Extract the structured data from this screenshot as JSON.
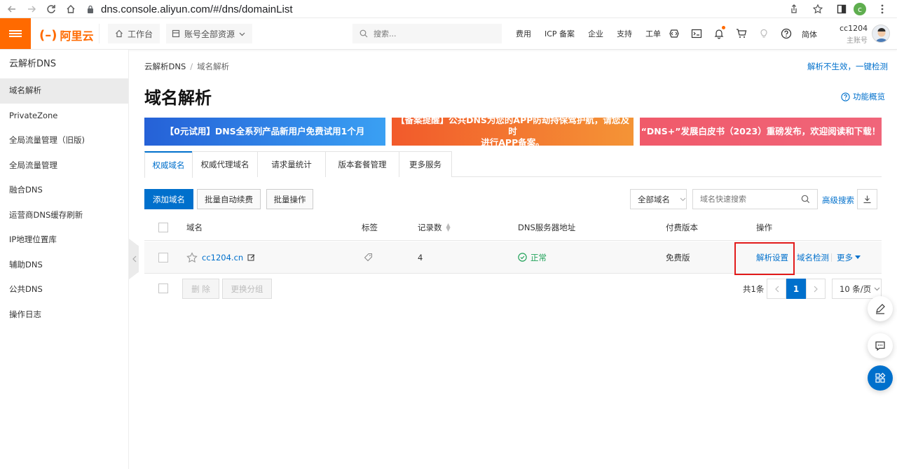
{
  "browser": {
    "url": "dns.console.aliyun.com/#/dns/domainList",
    "profile_letter": "c"
  },
  "header": {
    "logo_text": "阿里云",
    "workbench": "工作台",
    "resources": "账号全部资源",
    "search_placeholder": "搜索...",
    "links": [
      "费用",
      "ICP 备案",
      "企业",
      "支持",
      "工单"
    ],
    "lang": "简体",
    "username": "cc1204",
    "account_type": "主账号"
  },
  "sidebar": {
    "title": "云解析DNS",
    "items": [
      {
        "label": "域名解析",
        "active": true
      },
      {
        "label": "PrivateZone"
      },
      {
        "label": "全局流量管理（旧版)"
      },
      {
        "label": "全局流量管理"
      },
      {
        "label": "融合DNS"
      },
      {
        "label": "运营商DNS缓存刷新"
      },
      {
        "label": "IP地理位置库"
      },
      {
        "label": "辅助DNS"
      },
      {
        "label": "公共DNS"
      },
      {
        "label": "操作日志"
      }
    ]
  },
  "breadcrumb": {
    "root": "云解析DNS",
    "current": "域名解析"
  },
  "top_right_link": "解析不生效，一键检测",
  "page_title": "域名解析",
  "help_link": "功能概览",
  "banners": [
    {
      "text": "【0元试用】DNS全系列产品新用户免费试用1个月"
    },
    {
      "line1": "【备案提醒】公共DNS为您的APP防劫持保驾护航，请您及时",
      "line2": "进行APP备案。"
    },
    {
      "text": "“DNS+”发展白皮书（2023）重磅发布，欢迎阅读和下载！"
    }
  ],
  "tabs": [
    {
      "label": "权威域名",
      "active": true
    },
    {
      "label": "权威代理域名"
    },
    {
      "label": "请求量统计"
    },
    {
      "label": "版本套餐管理"
    },
    {
      "label": "更多服务"
    }
  ],
  "toolbar": {
    "add_domain": "添加域名",
    "batch_renew": "批量自动续费",
    "batch_ops": "批量操作",
    "filter_select": "全部域名",
    "search_placeholder": "域名快速搜索",
    "advanced_search": "高级搜索"
  },
  "table": {
    "headers": [
      "域名",
      "标签",
      "记录数",
      "DNS服务器地址",
      "付费版本",
      "操作"
    ],
    "rows": [
      {
        "domain": "cc1204.cn",
        "records": "4",
        "dns_status": "正常",
        "edition": "免费版",
        "actions": [
          "解析设置",
          "域名检测",
          "更多"
        ]
      }
    ]
  },
  "footer": {
    "delete": "删 除",
    "change_group": "更换分组",
    "total": "共1条",
    "current_page": "1",
    "page_size": "10 条/页"
  },
  "colors": {
    "brand": "#ff6a00",
    "primary": "#0070cc",
    "success": "#22a35a",
    "highlight": "#e21b1b"
  }
}
